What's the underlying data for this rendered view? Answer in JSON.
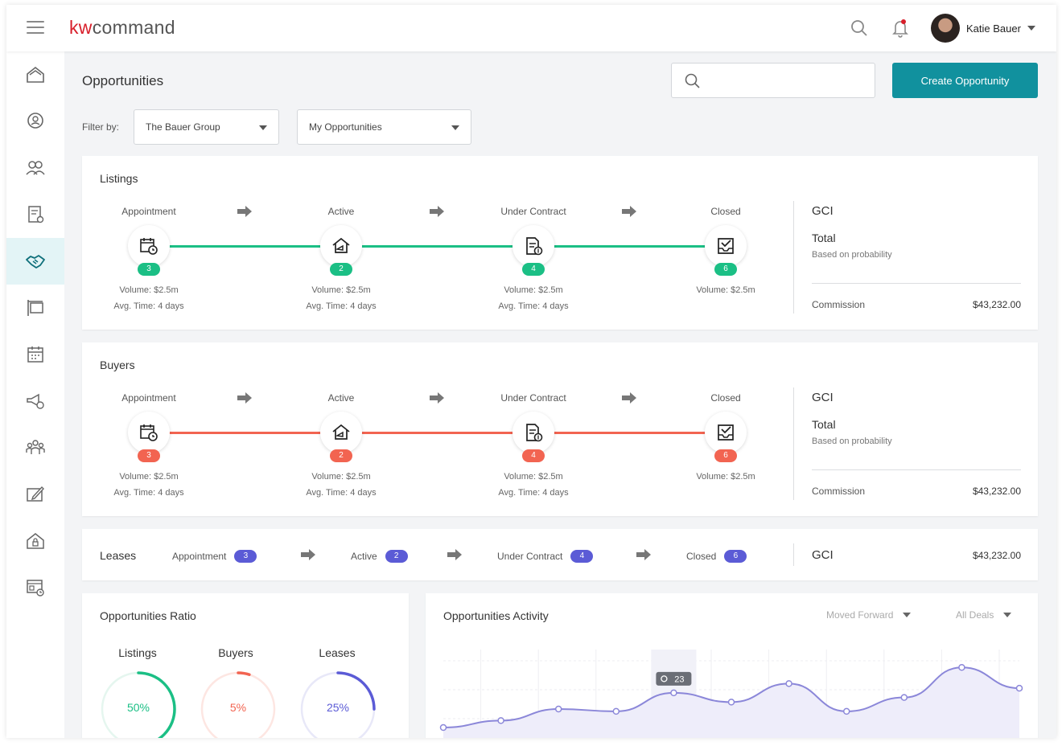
{
  "app": {
    "logo_kw": "kw",
    "logo_rest": "command"
  },
  "user": {
    "name": "Katie Bauer"
  },
  "sidebar": {
    "items": [
      {
        "name": "home-icon"
      },
      {
        "name": "location-pin-icon"
      },
      {
        "name": "contacts-icon"
      },
      {
        "name": "document-settings-icon"
      },
      {
        "name": "handshake-icon",
        "active": true
      },
      {
        "name": "frame-icon"
      },
      {
        "name": "calendar-icon"
      },
      {
        "name": "megaphone-icon"
      },
      {
        "name": "team-icon"
      },
      {
        "name": "edit-board-icon"
      },
      {
        "name": "house-lock-icon"
      },
      {
        "name": "dashboard-clock-icon"
      }
    ]
  },
  "page": {
    "title": "Opportunities",
    "create_label": "Create Opportunity",
    "filter_label": "Filter by:",
    "filter_group": "The Bauer Group",
    "filter_scope": "My Opportunities"
  },
  "listings": {
    "title": "Listings",
    "color": "#1bbf85",
    "stages": [
      {
        "label": "Appointment",
        "count": "3",
        "volume": "Volume: $2.5m",
        "time": "Avg. Time: 4 days"
      },
      {
        "label": "Active",
        "count": "2",
        "volume": "Volume: $2.5m",
        "time": "Avg. Time: 4 days"
      },
      {
        "label": "Under Contract",
        "count": "4",
        "volume": "Volume: $2.5m",
        "time": "Avg. Time: 4 days"
      },
      {
        "label": "Closed",
        "count": "6",
        "volume": "Volume: $2.5m",
        "time": ""
      }
    ],
    "gci": {
      "title": "GCI",
      "total": "Total",
      "sub": "Based on probability",
      "commission_label": "Commission",
      "commission_value": "$43,232.00"
    }
  },
  "buyers": {
    "title": "Buyers",
    "color": "#f26451",
    "stages": [
      {
        "label": "Appointment",
        "count": "3",
        "volume": "Volume: $2.5m",
        "time": "Avg. Time: 4 days"
      },
      {
        "label": "Active",
        "count": "2",
        "volume": "Volume: $2.5m",
        "time": "Avg. Time: 4 days"
      },
      {
        "label": "Under Contract",
        "count": "4",
        "volume": "Volume: $2.5m",
        "time": "Avg. Time: 4 days"
      },
      {
        "label": "Closed",
        "count": "6",
        "volume": "Volume: $2.5m",
        "time": ""
      }
    ],
    "gci": {
      "title": "GCI",
      "total": "Total",
      "sub": "Based on probability",
      "commission_label": "Commission",
      "commission_value": "$43,232.00"
    }
  },
  "leases": {
    "title": "Leases",
    "color": "#5b5bd6",
    "stages": [
      {
        "label": "Appointment",
        "count": "3"
      },
      {
        "label": "Active",
        "count": "2"
      },
      {
        "label": "Under Contract",
        "count": "4"
      },
      {
        "label": "Closed",
        "count": "6"
      }
    ],
    "gci_title": "GCI",
    "gci_value": "$43,232.00"
  },
  "ratio": {
    "title": "Opportunities Ratio",
    "items": [
      {
        "label": "Listings",
        "value": "50%",
        "pct": 50,
        "color": "#1bbf85"
      },
      {
        "label": "Buyers",
        "value": "5%",
        "pct": 5,
        "color": "#f26451"
      },
      {
        "label": "Leases",
        "value": "25%",
        "pct": 25,
        "color": "#5b5bd6"
      }
    ]
  },
  "activity": {
    "title": "Opportunities Activity",
    "filter_moved": "Moved Forward",
    "filter_deals": "All Deals",
    "tooltip_value": "23",
    "chart_data": {
      "type": "line",
      "title": "Opportunities Activity",
      "values": [
        8,
        11,
        16,
        15,
        23,
        19,
        27,
        15,
        21,
        34,
        25
      ],
      "highlight_index": 4,
      "color": "#8b87d9"
    }
  }
}
